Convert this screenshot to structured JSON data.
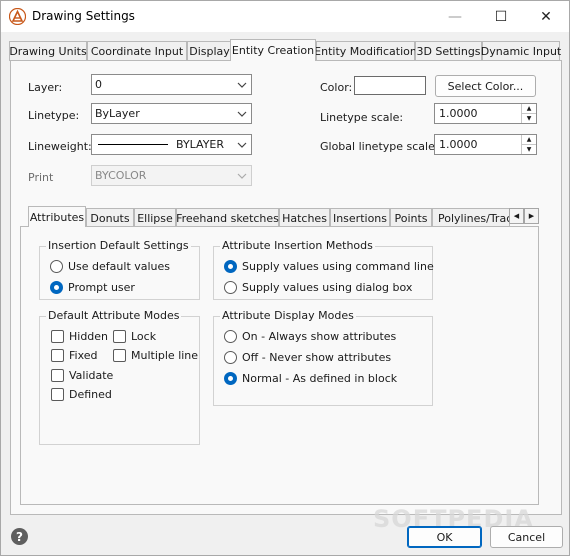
{
  "window": {
    "title": "Drawing Settings",
    "controls": {
      "minimize": "—",
      "maximize": "☐",
      "close": "✕"
    }
  },
  "tabs": [
    {
      "label": "Drawing Units"
    },
    {
      "label": "Coordinate Input"
    },
    {
      "label": "Display"
    },
    {
      "label": "Entity Creation",
      "active": true
    },
    {
      "label": "Entity Modification"
    },
    {
      "label": "3D Settings"
    },
    {
      "label": "Dynamic Input"
    }
  ],
  "entity": {
    "layer_label": "Layer:",
    "layer_value": "0",
    "linetype_label": "Linetype:",
    "linetype_value": "ByLayer",
    "lineweight_label": "Lineweight:",
    "lineweight_value": "BYLAYER",
    "print_label": "Print",
    "print_value": "BYCOLOR",
    "color_label": "Color:",
    "select_color_button": "Select Color...",
    "linetype_scale_label": "Linetype scale:",
    "linetype_scale_value": "1.0000",
    "global_scale_label": "Global linetype scale:",
    "global_scale_value": "1.0000"
  },
  "subtabs": [
    {
      "label": "Attributes",
      "active": true
    },
    {
      "label": "Donuts"
    },
    {
      "label": "Ellipse"
    },
    {
      "label": "Freehand sketches"
    },
    {
      "label": "Hatches"
    },
    {
      "label": "Insertions"
    },
    {
      "label": "Points"
    },
    {
      "label": "Polylines/Trace"
    }
  ],
  "attributes": {
    "insertion_defaults": {
      "title": "Insertion Default Settings",
      "options": [
        "Use default values",
        "Prompt user"
      ],
      "selected": "Prompt user"
    },
    "insertion_methods": {
      "title": "Attribute Insertion Methods",
      "options": [
        "Supply values using command line",
        "Supply values using dialog box"
      ],
      "selected": "Supply values using command line"
    },
    "default_modes": {
      "title": "Default Attribute Modes",
      "checks": [
        "Hidden",
        "Lock",
        "Fixed",
        "Multiple line",
        "Validate",
        "Defined"
      ]
    },
    "display_modes": {
      "title": "Attribute Display Modes",
      "options": [
        "On - Always show attributes",
        "Off - Never show attributes",
        "Normal - As defined in block"
      ],
      "selected": "Normal - As defined in block"
    }
  },
  "footer": {
    "help_icon": "?",
    "ok_button": "OK",
    "cancel_button": "Cancel"
  },
  "watermark": "SOFTPEDIA"
}
